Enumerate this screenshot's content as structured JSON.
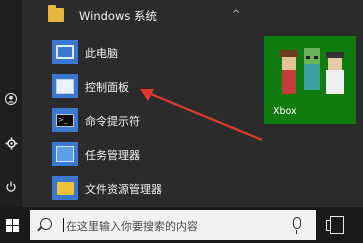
{
  "start_menu": {
    "folder": {
      "label": "Windows 系统",
      "chevron": "^"
    },
    "items": [
      {
        "label": "此电脑",
        "icon": "this-pc-icon"
      },
      {
        "label": "控制面板",
        "icon": "control-panel-icon"
      },
      {
        "label": "命令提示符",
        "icon": "command-prompt-icon"
      },
      {
        "label": "任务管理器",
        "icon": "task-manager-icon"
      },
      {
        "label": "文件资源管理器",
        "icon": "file-explorer-icon"
      }
    ],
    "rail_icons": [
      "user-icon",
      "settings-icon",
      "power-icon"
    ],
    "tile": {
      "label": "Xbox",
      "color": "#107c10"
    }
  },
  "taskbar": {
    "search_placeholder": "在这里输入你要搜索的内容"
  },
  "annotation": {
    "color": "#e03a2f"
  }
}
